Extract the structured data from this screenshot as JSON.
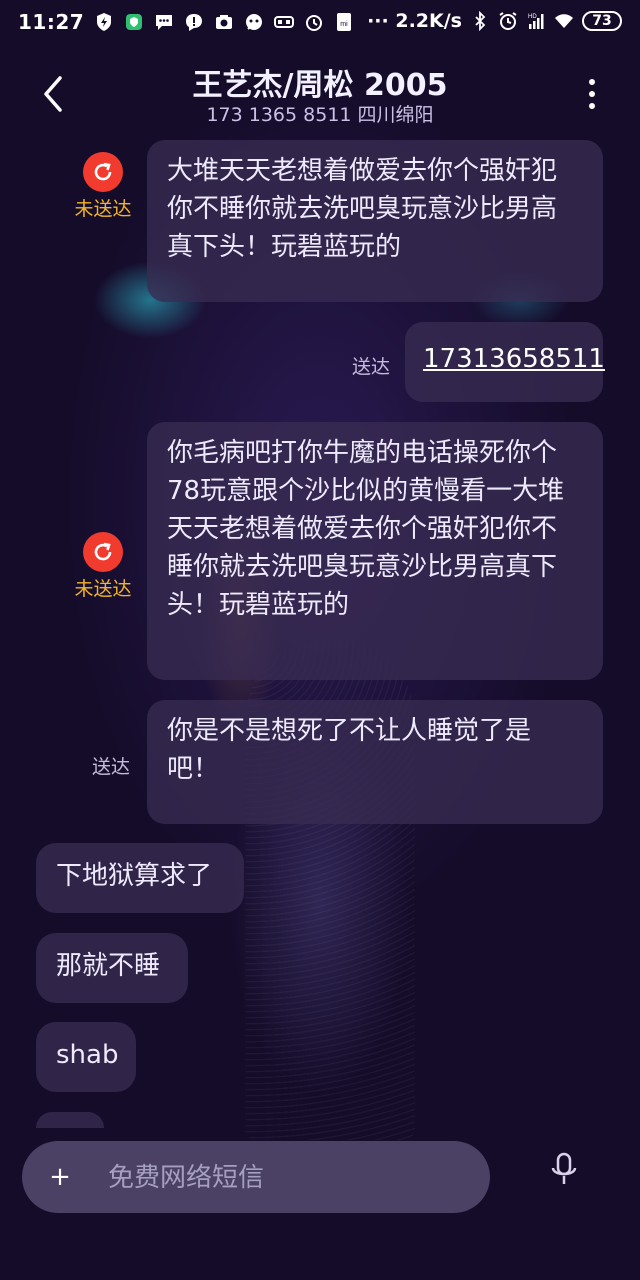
{
  "status_bar": {
    "time": "11:27",
    "speed": "··· 2.2K/s",
    "battery": "73"
  },
  "header": {
    "title": "王艺杰/周松 2005",
    "subtitle": "173 1365 8511 四川绵阳"
  },
  "messages": [
    {
      "direction": "out",
      "status": "未送达",
      "failed": true,
      "text": "大堆天天老想着做爱去你个强奸犯你不睡你就去洗吧臭玩意沙比男高真下头！玩碧蓝玩的"
    },
    {
      "direction": "out",
      "status": "送达",
      "failed": false,
      "text": "17313658511",
      "is_link": true
    },
    {
      "direction": "out",
      "status": "未送达",
      "failed": true,
      "text": "你毛病吧打你牛魔的电话操死你个78玩意跟个沙比似的黄慢看一大堆天天老想着做爱去你个强奸犯你不睡你就去洗吧臭玩意沙比男高真下头！玩碧蓝玩的"
    },
    {
      "direction": "out",
      "status": "送达",
      "failed": false,
      "text": "你是不是想死了不让人睡觉了是吧！"
    },
    {
      "direction": "in",
      "text": "下地狱算求了"
    },
    {
      "direction": "in",
      "text": "那就不睡"
    },
    {
      "direction": "in",
      "text": "shab"
    }
  ],
  "input": {
    "placeholder": "免费网络短信",
    "plus": "+"
  },
  "icons": {
    "back": "chevron-left-icon",
    "more": "more-vertical-icon",
    "retry": "refresh-icon",
    "mic": "microphone-icon"
  },
  "colors": {
    "failed_icon": "#f23b2f",
    "failed_text": "#f2b52a",
    "bubble": "#382c52"
  }
}
